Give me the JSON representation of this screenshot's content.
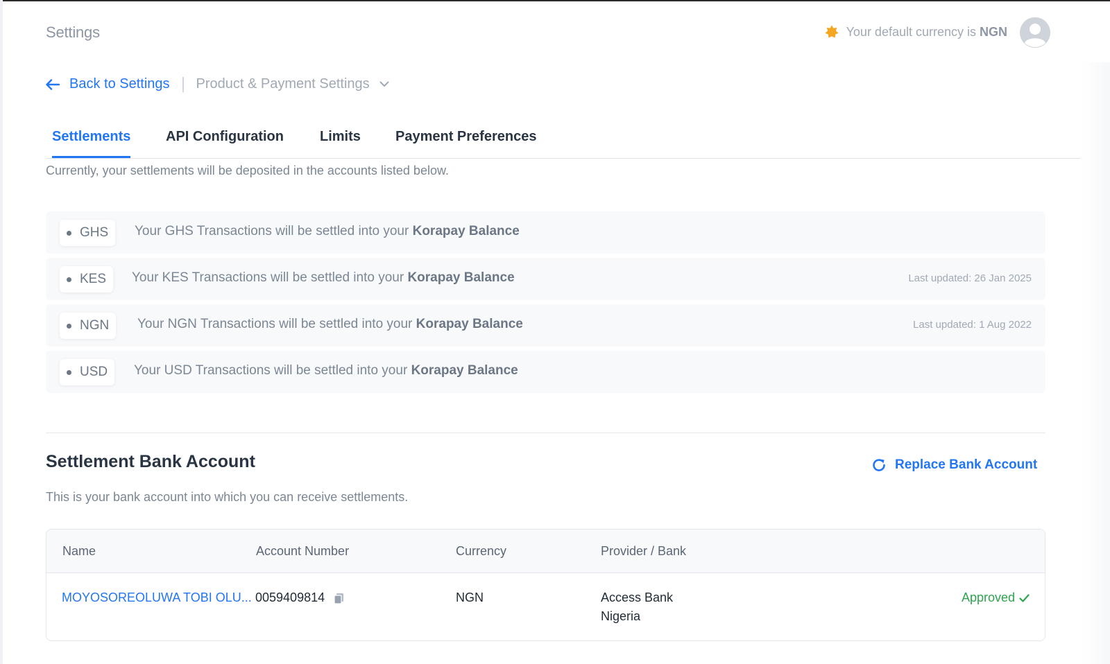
{
  "header": {
    "title": "Settings",
    "currency_prefix": "Your default currency is",
    "currency_code": "NGN"
  },
  "breadcrumb": {
    "back_label": "Back to Settings",
    "current_label": "Product & Payment Settings"
  },
  "tabs": [
    {
      "label": "Settlements",
      "active": true
    },
    {
      "label": "API Configuration",
      "active": false
    },
    {
      "label": "Limits",
      "active": false
    },
    {
      "label": "Payment Preferences",
      "active": false
    }
  ],
  "intro_text": "Currently, your settlements will be deposited in the accounts listed below.",
  "settlements": [
    {
      "currency": "GHS",
      "text": "Your GHS Transactions will be settled into your",
      "destination": "Korapay Balance",
      "updated": ""
    },
    {
      "currency": "KES",
      "text": "Your KES Transactions will be settled into your",
      "destination": "Korapay Balance",
      "updated": "Last updated: 26 Jan 2025"
    },
    {
      "currency": "NGN",
      "text": "Your NGN Transactions will be settled into your",
      "destination": "Korapay Balance",
      "updated": "Last updated: 1 Aug 2022"
    },
    {
      "currency": "USD",
      "text": "Your USD Transactions will be settled into your",
      "destination": "Korapay Balance",
      "updated": ""
    }
  ],
  "bank_section": {
    "title": "Settlement Bank Account",
    "subtitle": "This is your bank account into which you can receive settlements.",
    "replace_label": "Replace Bank Account"
  },
  "bank_table": {
    "headers": [
      "Name",
      "Account Number",
      "Currency",
      "Provider / Bank"
    ],
    "row": {
      "name": "MOYOSOREOLUWA TOBI OLU...",
      "account_number": "0059409814",
      "currency": "NGN",
      "bank_line1": "Access Bank",
      "bank_line2": "Nigeria",
      "status": "Approved"
    }
  },
  "colors": {
    "accent": "#2376f3",
    "status_approved": "#2da44e",
    "star": "#f5a623"
  },
  "icons": [
    "star-icon",
    "avatar-icon",
    "arrow-left-icon",
    "chevron-down-icon",
    "refresh-icon",
    "copy-icon",
    "checkmark-icon"
  ]
}
